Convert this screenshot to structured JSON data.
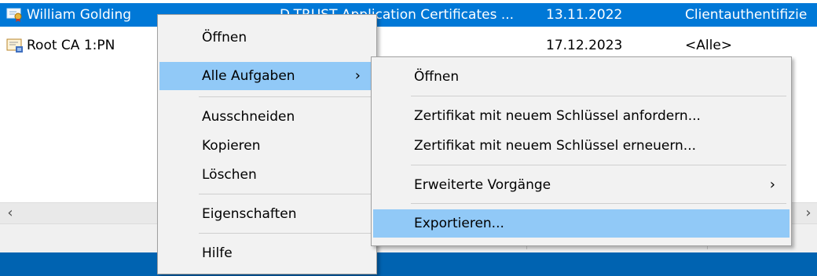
{
  "rows": [
    {
      "name": "William Golding",
      "issuer": "D-TRUST Application Certificates ...",
      "expires": "13.11.2022",
      "purpose": "Clientauthentifizie",
      "selected": true
    },
    {
      "name": "Root CA 1:PN",
      "issuer": "",
      "expires": "17.12.2023",
      "purpose": "<Alle>",
      "selected": false
    }
  ],
  "context_menu": {
    "items": [
      {
        "label": "Öffnen"
      },
      {
        "label": "Alle Aufgaben",
        "has_submenu": true,
        "highlighted": true
      },
      {
        "label": "Ausschneiden"
      },
      {
        "label": "Kopieren"
      },
      {
        "label": "Löschen"
      },
      {
        "label": "Eigenschaften"
      },
      {
        "label": "Hilfe"
      }
    ]
  },
  "submenu": {
    "items": [
      {
        "label": "Öffnen"
      },
      {
        "label": "Zertifikat mit neuem Schlüssel anfordern..."
      },
      {
        "label": "Zertifikat mit neuem Schlüssel erneuern..."
      },
      {
        "label": "Erweiterte Vorgänge",
        "has_submenu": true
      },
      {
        "label": "Exportieren...",
        "highlighted": true
      }
    ]
  },
  "glyphs": {
    "chevron_right": "›",
    "scroll_left": "‹",
    "scroll_right": "›"
  },
  "colors": {
    "selection": "#0078d7",
    "menu_highlight": "#91c9f7",
    "menu_background": "#f2f2f2",
    "taskbar": "#0063b1"
  },
  "icons": [
    "certificate-ribbon-icon",
    "certificate-icon",
    "chevron-right-icon",
    "scroll-left-arrow-icon",
    "scroll-right-arrow-icon"
  ]
}
